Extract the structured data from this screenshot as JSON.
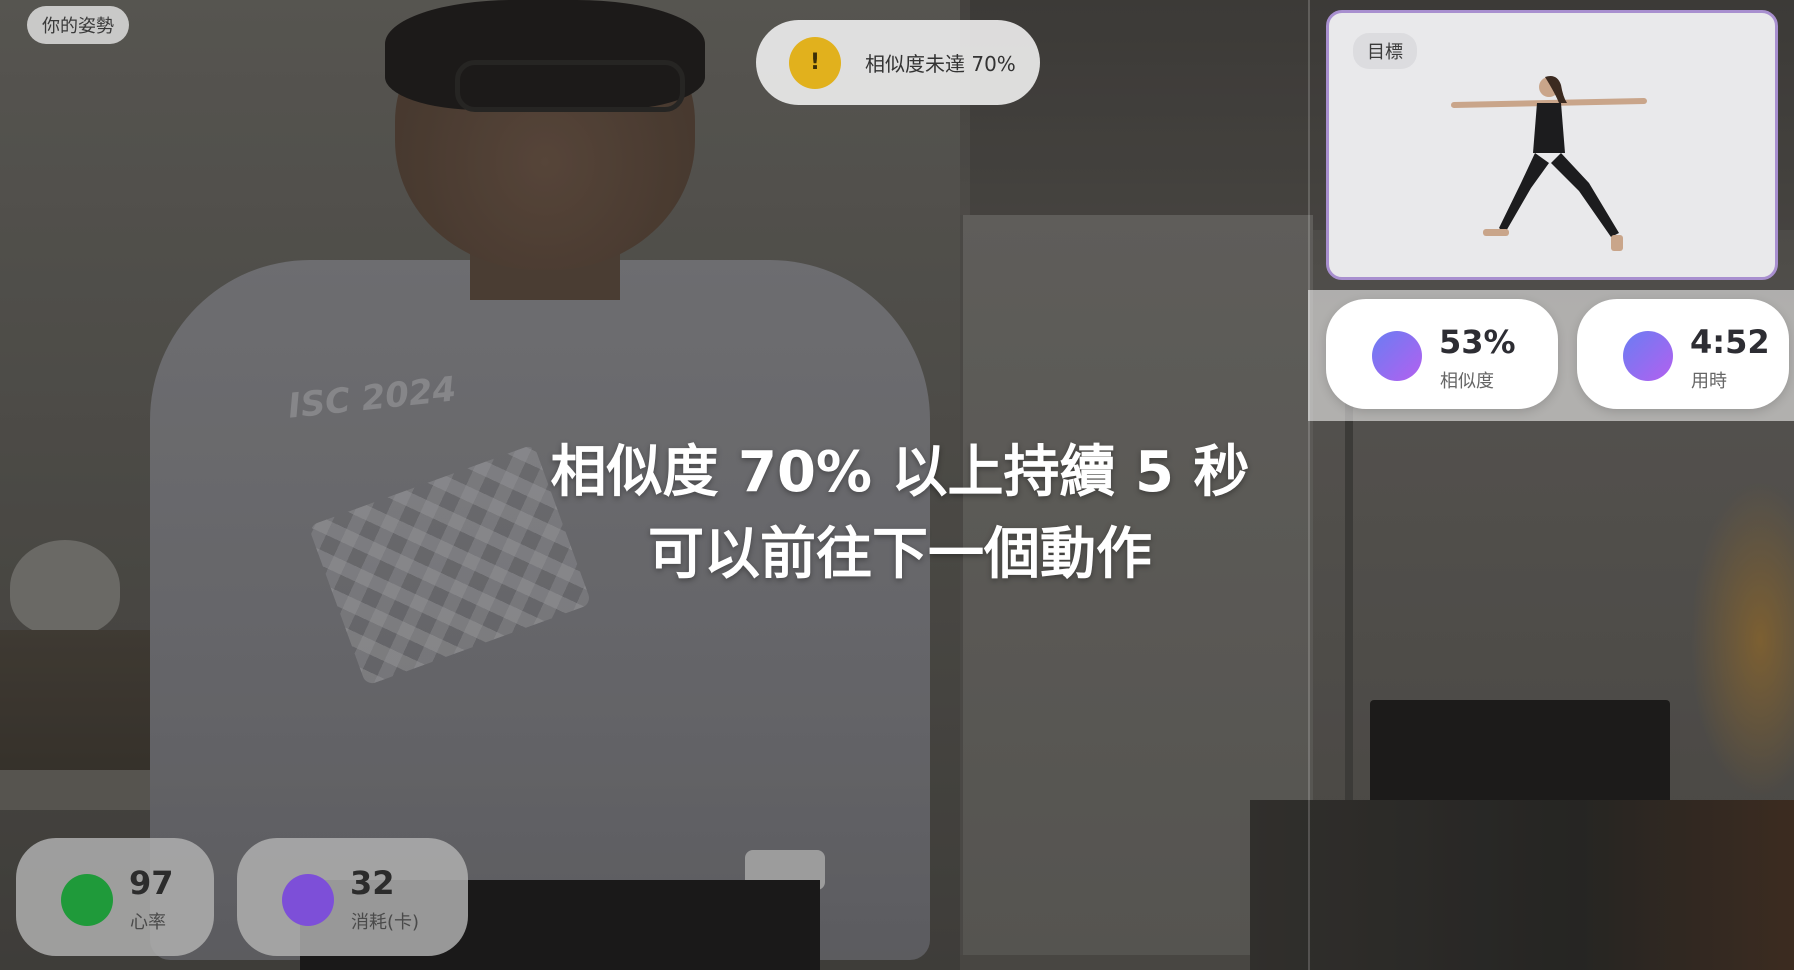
{
  "pose_tag": "你的姿勢",
  "warning": {
    "icon": "!",
    "text": "相似度未達 70%",
    "color": "#e1b11d"
  },
  "target": {
    "label": "目標"
  },
  "stats": {
    "similarity": {
      "value": "53%",
      "label": "相似度"
    },
    "time": {
      "value": "4:52",
      "label": "用時"
    }
  },
  "instruction": {
    "line1": "相似度 70% 以上持續 5 秒",
    "line2": "可以前往下一個動作"
  },
  "bottom": {
    "heart_rate": {
      "value": "97",
      "label": "心率",
      "color": "#1f9a3a"
    },
    "calories": {
      "value": "32",
      "label": "消耗(卡)",
      "color": "#7d4fd8"
    }
  },
  "shirt_print": "ISC 2024"
}
